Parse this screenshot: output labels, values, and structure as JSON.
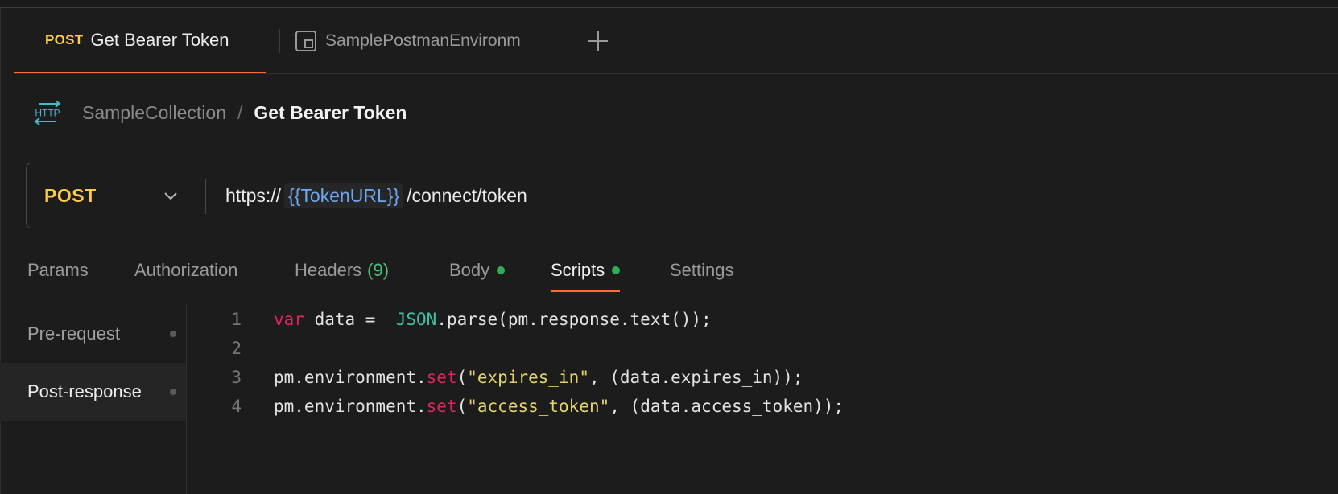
{
  "tabs": {
    "active": {
      "method": "POST",
      "title": "Get Bearer Token"
    },
    "environment": {
      "label": "SamplePostmanEnvironm"
    }
  },
  "breadcrumb": {
    "collection": "SampleCollection",
    "separator": "/",
    "current": "Get Bearer Token",
    "icon_text": "HTTP"
  },
  "request": {
    "method": "POST",
    "url_prefix": "https://",
    "url_variable": "{{TokenURL}}",
    "url_suffix": "/connect/token"
  },
  "request_tabs": [
    {
      "label": "Params"
    },
    {
      "label": "Authorization"
    },
    {
      "label": "Headers",
      "count": "(9)"
    },
    {
      "label": "Body"
    },
    {
      "label": "Scripts"
    },
    {
      "label": "Settings"
    }
  ],
  "scripts_nav": [
    {
      "label": "Pre-request"
    },
    {
      "label": "Post-response"
    }
  ],
  "code_lines": [
    {
      "number": "1",
      "tokens": [
        {
          "t": "var",
          "c": "kw"
        },
        {
          "t": " data =  ",
          "c": ""
        },
        {
          "t": "JSON",
          "c": "obj"
        },
        {
          "t": ".parse(pm.response.text());",
          "c": ""
        }
      ]
    },
    {
      "number": "2",
      "tokens": []
    },
    {
      "number": "3",
      "tokens": [
        {
          "t": "pm.environment.",
          "c": ""
        },
        {
          "t": "set",
          "c": "kw"
        },
        {
          "t": "(",
          "c": ""
        },
        {
          "t": "\"expires_in\"",
          "c": "str"
        },
        {
          "t": ", (data.expires_in));",
          "c": ""
        }
      ]
    },
    {
      "number": "4",
      "tokens": [
        {
          "t": "pm.environment.",
          "c": ""
        },
        {
          "t": "set",
          "c": "kw"
        },
        {
          "t": "(",
          "c": ""
        },
        {
          "t": "\"access_token\"",
          "c": "str"
        },
        {
          "t": ", (data.access_token));",
          "c": ""
        }
      ]
    }
  ],
  "colors": {
    "accent": "#ff6c37",
    "method_post": "#ffcb45",
    "variable": "#6fa8f0",
    "keyword": "#e0245e",
    "object": "#3fbfa3",
    "string": "#e4d36a",
    "status_dot": "#2fae55"
  },
  "icons": {
    "env_tab": "environment-icon",
    "new_tab": "plus-icon",
    "request_type": "http-icon",
    "method_dropdown": "chevron-down-icon"
  }
}
